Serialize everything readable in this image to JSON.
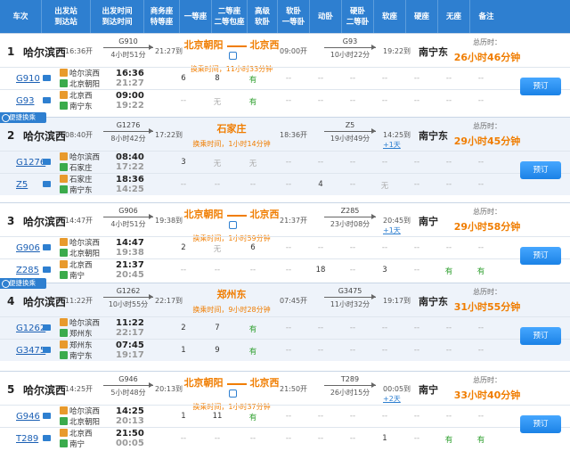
{
  "header": [
    "车次",
    "出发站\n到达站",
    "出发时间\n到达时间",
    "商务座\n特等座",
    "一等座",
    "二等座\n二等包座",
    "高级\n软卧",
    "软卧\n一等卧",
    "动卧",
    "硬卧\n二等卧",
    "软座",
    "硬座",
    "无座",
    "备注"
  ],
  "badge_label": "便捷换乘",
  "book_label": "预订",
  "total_label": "总历时：",
  "groups": [
    {
      "no": "1",
      "start": "哈尔滨西",
      "dep": "16:36开",
      "t1": {
        "code": "G910",
        "dur": "4小时51分"
      },
      "arr1": "21:27到",
      "xfer_a": "北京朝阳",
      "xfer_b": "北京西",
      "wait": "换乘时间，11小时33分钟",
      "dep2": "09:00开",
      "t2": {
        "code": "G93",
        "dur": "10小时22分"
      },
      "arr2": "19:22到",
      "plus": "",
      "dest": "南宁东",
      "total": "26小时46分钟",
      "legs": [
        {
          "train": "G910",
          "from": "哈尔滨西",
          "to": "北京朝阳",
          "t_dep": "16:36",
          "t_arr": "21:27",
          "seats": [
            "6",
            "8",
            "有",
            "--",
            "--",
            "--",
            "--",
            "--",
            "--",
            "--"
          ]
        },
        {
          "train": "G93",
          "from": "北京西",
          "to": "南宁东",
          "t_dep": "09:00",
          "t_arr": "19:22",
          "seats": [
            "--",
            "无",
            "有",
            "--",
            "--",
            "--",
            "--",
            "--",
            "--",
            "--"
          ]
        }
      ]
    },
    {
      "no": "2",
      "start": "哈尔滨西",
      "dep": "08:40开",
      "t1": {
        "code": "G1276",
        "dur": "8小时42分"
      },
      "arr1": "17:22到",
      "xfer_a": "石家庄",
      "xfer_b": "",
      "wait": "换乘时间，1小时14分钟",
      "dep2": "18:36开",
      "t2": {
        "code": "Z5",
        "dur": "19小时49分"
      },
      "arr2": "14:25到",
      "plus": "+1天",
      "dest": "南宁东",
      "total": "29小时45分钟",
      "legs": [
        {
          "train": "G1276",
          "from": "哈尔滨西",
          "to": "石家庄",
          "t_dep": "08:40",
          "t_arr": "17:22",
          "seats": [
            "3",
            "无",
            "无",
            "--",
            "--",
            "--",
            "--",
            "--",
            "--",
            "--"
          ]
        },
        {
          "train": "Z5",
          "from": "石家庄",
          "to": "南宁东",
          "t_dep": "18:36",
          "t_arr": "14:25",
          "seats": [
            "--",
            "--",
            "--",
            "--",
            "4",
            "--",
            "无",
            "--",
            "--",
            "--"
          ]
        }
      ]
    },
    {
      "no": "3",
      "start": "哈尔滨西",
      "dep": "14:47开",
      "t1": {
        "code": "G906",
        "dur": "4小时51分"
      },
      "arr1": "19:38到",
      "xfer_a": "北京朝阳",
      "xfer_b": "北京西",
      "wait": "换乘时间，1小时59分钟",
      "dep2": "21:37开",
      "t2": {
        "code": "Z285",
        "dur": "23小时08分"
      },
      "arr2": "20:45到",
      "plus": "+1天",
      "dest": "南宁",
      "total": "29小时58分钟",
      "legs": [
        {
          "train": "G906",
          "from": "哈尔滨西",
          "to": "北京朝阳",
          "t_dep": "14:47",
          "t_arr": "19:38",
          "seats": [
            "2",
            "无",
            "6",
            "--",
            "--",
            "--",
            "--",
            "--",
            "--",
            "--"
          ]
        },
        {
          "train": "Z285",
          "from": "北京西",
          "to": "南宁",
          "t_dep": "21:37",
          "t_arr": "20:45",
          "seats": [
            "--",
            "--",
            "--",
            "--",
            "18",
            "--",
            "3",
            "--",
            "有",
            "有"
          ]
        }
      ]
    },
    {
      "no": "4",
      "start": "哈尔滨西",
      "dep": "11:22开",
      "t1": {
        "code": "G1262",
        "dur": "10小时55分"
      },
      "arr1": "22:17到",
      "xfer_a": "郑州东",
      "xfer_b": "",
      "wait": "换乘时间，9小时28分钟",
      "dep2": "07:45开",
      "t2": {
        "code": "G3475",
        "dur": "11小时32分"
      },
      "arr2": "19:17到",
      "plus": "",
      "dest": "南宁东",
      "total": "31小时55分钟",
      "legs": [
        {
          "train": "G1262",
          "from": "哈尔滨西",
          "to": "郑州东",
          "t_dep": "11:22",
          "t_arr": "22:17",
          "seats": [
            "2",
            "7",
            "有",
            "--",
            "--",
            "--",
            "--",
            "--",
            "--",
            "--"
          ]
        },
        {
          "train": "G3475",
          "from": "郑州东",
          "to": "南宁东",
          "t_dep": "07:45",
          "t_arr": "19:17",
          "seats": [
            "1",
            "9",
            "有",
            "--",
            "--",
            "--",
            "--",
            "--",
            "--",
            "--"
          ]
        }
      ]
    },
    {
      "no": "5",
      "start": "哈尔滨西",
      "dep": "14:25开",
      "t1": {
        "code": "G946",
        "dur": "5小时48分"
      },
      "arr1": "20:13到",
      "xfer_a": "北京朝阳",
      "xfer_b": "北京西",
      "wait": "换乘时间，1小时37分钟",
      "dep2": "21:50开",
      "t2": {
        "code": "T289",
        "dur": "26小时15分"
      },
      "arr2": "00:05到",
      "plus": "+2天",
      "dest": "南宁",
      "total": "33小时40分钟",
      "legs": [
        {
          "train": "G946",
          "from": "哈尔滨西",
          "to": "北京朝阳",
          "t_dep": "14:25",
          "t_arr": "20:13",
          "seats": [
            "1",
            "11",
            "有",
            "--",
            "--",
            "--",
            "--",
            "--",
            "--",
            "--"
          ]
        },
        {
          "train": "T289",
          "from": "北京西",
          "to": "南宁",
          "t_dep": "21:50",
          "t_arr": "00:05",
          "seats": [
            "--",
            "--",
            "--",
            "--",
            "--",
            "--",
            "1",
            "--",
            "有",
            "有"
          ]
        }
      ]
    }
  ]
}
